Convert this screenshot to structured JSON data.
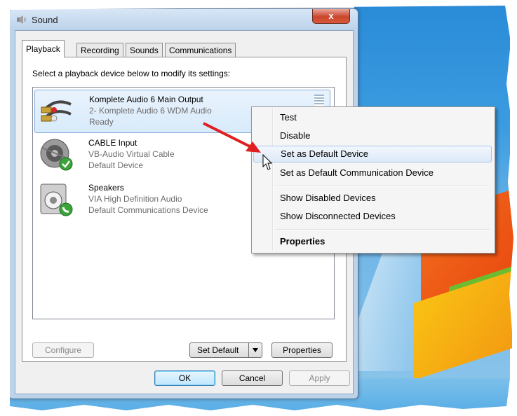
{
  "window": {
    "title": "Sound",
    "close_label": "x"
  },
  "tabs": [
    {
      "label": "Playback",
      "active": true
    },
    {
      "label": "Recording"
    },
    {
      "label": "Sounds"
    },
    {
      "label": "Communications"
    }
  ],
  "instruction": "Select a playback device below to modify its settings:",
  "devices": [
    {
      "name": "Komplete Audio 6 Main Output",
      "detail": "2- Komplete Audio 6 WDM Audio",
      "status": "Ready",
      "icon": "audio-cable-icon",
      "selected": true
    },
    {
      "name": "CABLE Input",
      "detail": "VB-Audio Virtual Cable",
      "status": "Default Device",
      "icon": "speaker-default-check-icon"
    },
    {
      "name": "Speakers",
      "detail": "VIA High Definition Audio",
      "status": "Default Communications Device",
      "icon": "speaker-phone-icon"
    }
  ],
  "buttons": {
    "configure": "Configure",
    "set_default": "Set Default",
    "properties": "Properties",
    "ok": "OK",
    "cancel": "Cancel",
    "apply": "Apply"
  },
  "context_menu": {
    "items": [
      {
        "label": "Test"
      },
      {
        "label": "Disable"
      },
      {
        "label": "Set as Default Device",
        "highlighted": true
      },
      {
        "label": "Set as Default Communication Device"
      },
      {
        "label": "Show Disabled Devices"
      },
      {
        "label": "Show Disconnected Devices"
      },
      {
        "label": "Properties",
        "bold": true
      }
    ]
  },
  "colors": {
    "arrow": "#e02020",
    "highlight": "#dde9f8",
    "selection": "#d8eafb"
  }
}
